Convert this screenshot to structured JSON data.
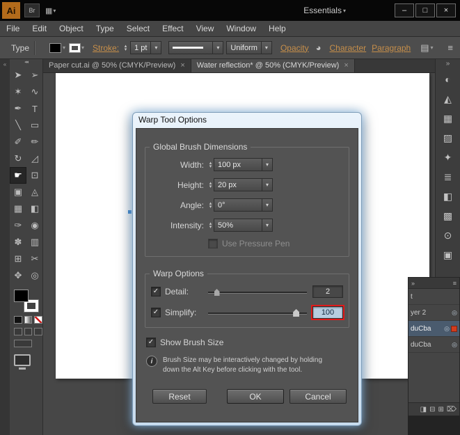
{
  "titlebar": {
    "logo": "Ai",
    "bridge": "Br",
    "workspace": "Essentials",
    "minimize": "–",
    "restore": "□",
    "close": "×"
  },
  "menu": {
    "items": [
      "File",
      "Edit",
      "Object",
      "Type",
      "Select",
      "Effect",
      "View",
      "Window",
      "Help"
    ]
  },
  "controlbar": {
    "tool_label": "Type",
    "stroke_label": "Stroke:",
    "stroke_value": "1 pt",
    "brush_style": "Uniform",
    "opacity_label": "Opacity",
    "character_label": "Character",
    "paragraph_label": "Paragraph"
  },
  "tabs": [
    {
      "label": "Paper cut.ai @ 50% (CMYK/Preview)",
      "close": "×"
    },
    {
      "label": "Water reflection* @ 50% (CMYK/Preview)",
      "close": "×"
    }
  ],
  "tools": [
    {
      "name": "selection",
      "glyph": "➤"
    },
    {
      "name": "direct-selection",
      "glyph": "➢"
    },
    {
      "name": "magic-wand",
      "glyph": "✶"
    },
    {
      "name": "lasso",
      "glyph": "∿"
    },
    {
      "name": "pen",
      "glyph": "✒"
    },
    {
      "name": "type",
      "glyph": "T"
    },
    {
      "name": "line-segment",
      "glyph": "╲"
    },
    {
      "name": "rectangle",
      "glyph": "▭"
    },
    {
      "name": "paintbrush",
      "glyph": "✐"
    },
    {
      "name": "pencil",
      "glyph": "✏"
    },
    {
      "name": "rotate",
      "glyph": "↻"
    },
    {
      "name": "scale",
      "glyph": "◿"
    },
    {
      "name": "warp",
      "glyph": "☛"
    },
    {
      "name": "free-transform",
      "glyph": "⊡"
    },
    {
      "name": "shape-builder",
      "glyph": "▣"
    },
    {
      "name": "perspective-grid",
      "glyph": "◬"
    },
    {
      "name": "mesh",
      "glyph": "▦"
    },
    {
      "name": "gradient",
      "glyph": "◧"
    },
    {
      "name": "eyedropper",
      "glyph": "✑"
    },
    {
      "name": "blend",
      "glyph": "◉"
    },
    {
      "name": "symbol-sprayer",
      "glyph": "✽"
    },
    {
      "name": "column-graph",
      "glyph": "▥"
    },
    {
      "name": "artboard",
      "glyph": "⊞"
    },
    {
      "name": "slice",
      "glyph": "✂"
    },
    {
      "name": "hand",
      "glyph": "✥"
    },
    {
      "name": "zoom",
      "glyph": "◎"
    }
  ],
  "dock_icons": [
    {
      "name": "color",
      "glyph": "◐"
    },
    {
      "name": "color-guide",
      "glyph": "◭"
    },
    {
      "name": "swatches",
      "glyph": "▦"
    },
    {
      "name": "brushes",
      "glyph": "▨"
    },
    {
      "name": "symbols",
      "glyph": "✦"
    },
    {
      "name": "stroke",
      "glyph": "≣"
    },
    {
      "name": "gradient",
      "glyph": "◧"
    },
    {
      "name": "transparency",
      "glyph": "▩"
    },
    {
      "name": "appearance",
      "glyph": "⊙"
    },
    {
      "name": "graphic-styles",
      "glyph": "▣"
    }
  ],
  "layers": {
    "collapse": "»",
    "menu": "≡",
    "rows": [
      {
        "label": "t"
      },
      {
        "label": "yer 2"
      },
      {
        "label": "duCba"
      },
      {
        "label": "duCba"
      }
    ],
    "footer": [
      "◨",
      "⊟",
      "⊞",
      "⌦"
    ]
  },
  "dialog": {
    "title": "Warp Tool Options",
    "global": {
      "title": "Global Brush Dimensions",
      "fields": [
        {
          "label": "Width:",
          "value": "100 px"
        },
        {
          "label": "Height:",
          "value": "20 px"
        },
        {
          "label": "Angle:",
          "value": "0°"
        },
        {
          "label": "Intensity:",
          "value": "50%"
        }
      ],
      "pressure_label": "Use Pressure Pen"
    },
    "warp": {
      "title": "Warp Options",
      "detail_label": "Detail:",
      "detail_value": "2",
      "simplify_label": "Simplify:",
      "simplify_value": "100"
    },
    "show_brush_label": "Show Brush Size",
    "info_line1": "Brush Size may be interactively changed by holding",
    "info_line2": "down the Alt Key before clicking with the tool.",
    "reset_label": "Reset",
    "ok_label": "OK",
    "cancel_label": "Cancel"
  },
  "icons": {
    "check": "✓",
    "dropdown": "▾",
    "up": "▴",
    "down": "▾",
    "left_collapse": "«",
    "grip": "◂◂",
    "dock_collapse": "»",
    "workspace_grid": "▦",
    "recolor": "◕",
    "stack": "▤",
    "panel_menu": "≡",
    "info": "i"
  },
  "colors": {
    "logo_orange": "#b36b1b",
    "selection_blue": "#4a5b6e",
    "highlight_red": "#e01b1b"
  }
}
